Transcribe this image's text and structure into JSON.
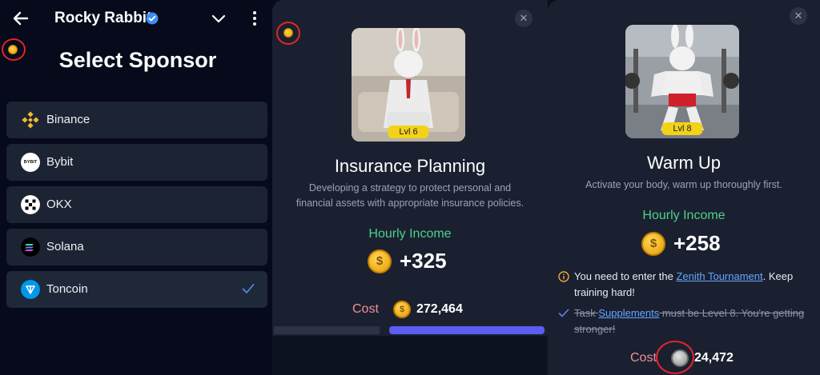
{
  "app": {
    "title": "Rocky Rabbit"
  },
  "left": {
    "heading": "Select Sponsor",
    "sponsors": [
      {
        "label": "Binance",
        "icon": "binance-icon",
        "color": "#f3ba2f",
        "selected": false
      },
      {
        "label": "Bybit",
        "icon": "bybit-icon",
        "color": "#ffffff",
        "selected": false
      },
      {
        "label": "OKX",
        "icon": "okx-icon",
        "color": "#ffffff",
        "selected": false
      },
      {
        "label": "Solana",
        "icon": "solana-icon",
        "color": "#000000",
        "selected": false
      },
      {
        "label": "Toncoin",
        "icon": "toncoin-icon",
        "color": "#0098ea",
        "selected": true
      }
    ],
    "bybit_logo_text": "BYBIT"
  },
  "middle": {
    "level": "Lvl 6",
    "title": "Insurance Planning",
    "description_line1": "Developing a strategy to protect personal and",
    "description_line2": "financial assets with appropriate insurance policies.",
    "income_label": "Hourly Income",
    "income_value": "+325",
    "cost_label": "Cost",
    "cost_value": "272,464",
    "close_symbol": "✕"
  },
  "right": {
    "level": "Lvl 8",
    "title": "Warm Up",
    "description": "Activate your body, warm up thoroughly first.",
    "income_label": "Hourly Income",
    "income_value": "+258",
    "notice1": {
      "prefix": "You need to enter the ",
      "link": "Zenith Tournament",
      "suffix": ". Keep training hard!"
    },
    "notice2": {
      "prefix": "Task ",
      "link": "Supplements",
      "suffix": " must be Level 8. You're getting stronger!"
    },
    "cost_label": "Cost",
    "cost_value": "24,472",
    "close_symbol": "✕"
  },
  "colors": {
    "income_green": "#4fd08a",
    "cost_pink": "#f08f95",
    "accent_blue": "#5b5df0",
    "link_blue": "#66a6ff",
    "highlight_red": "#e3242b"
  }
}
